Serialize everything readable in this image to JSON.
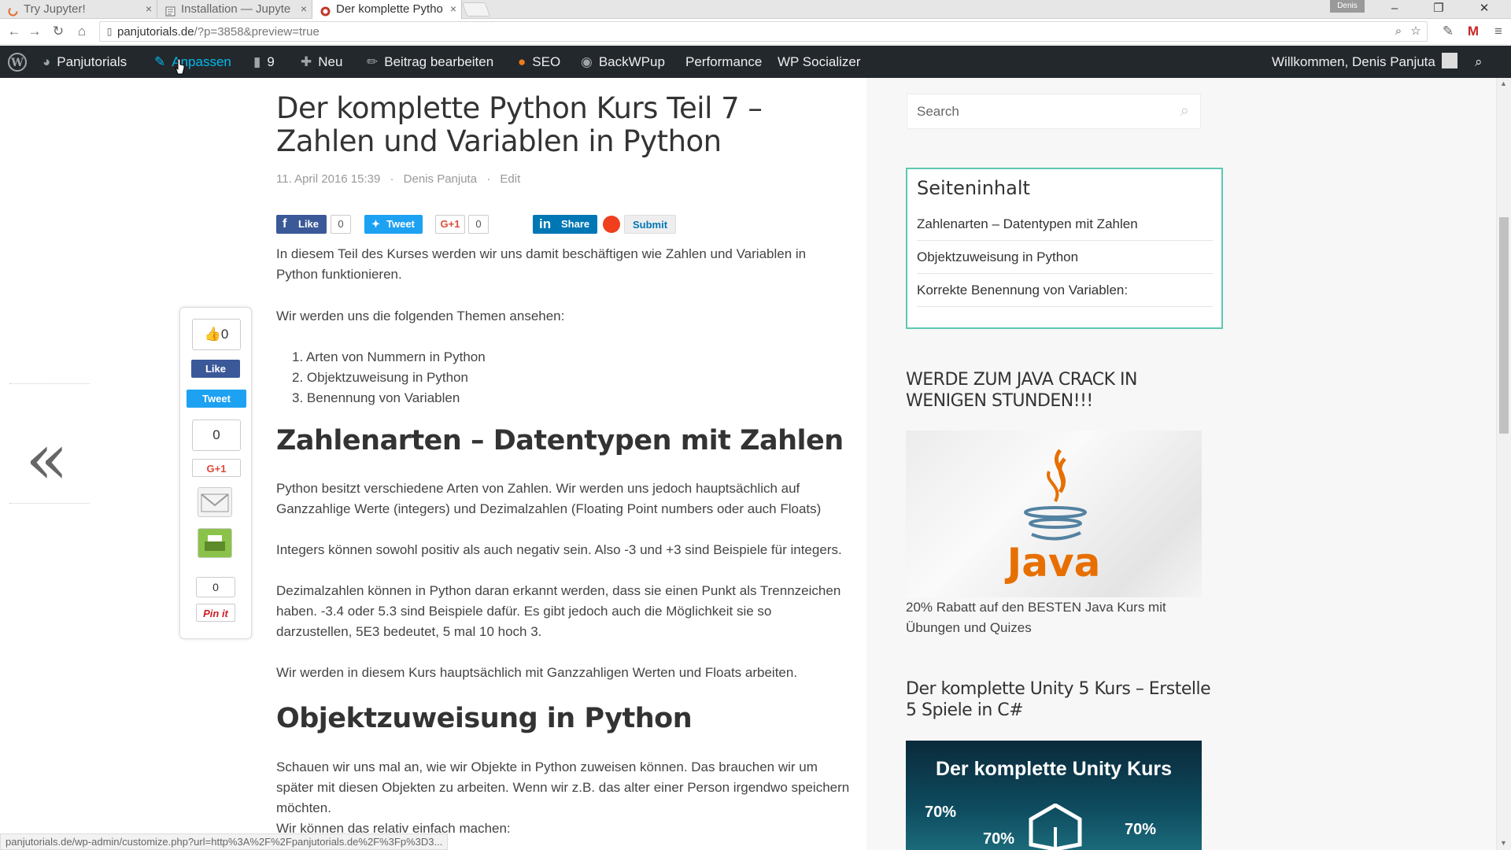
{
  "browser": {
    "tabs": [
      {
        "title": "Try Jupyter!",
        "close": "×"
      },
      {
        "title": "Installation — Jupyte",
        "close": "×"
      },
      {
        "title": "Der komplette Pytho",
        "close": "×"
      }
    ],
    "profile_name": "Denis",
    "window_controls": {
      "minimize": "–",
      "restore": "❐",
      "close": "✕"
    },
    "url": {
      "domain": "panjutorials.de",
      "path": "/?p=3858&preview=true"
    },
    "status_url": "panjutorials.de/wp-admin/customize.php?url=http%3A%2F%2Fpanjutorials.de%2F%3Fp%3D3..."
  },
  "adminbar": {
    "site": "Panjutorials",
    "customize": "Anpassen",
    "comments_count": "9",
    "new": "Neu",
    "edit_post": "Beitrag bearbeiten",
    "seo": "SEO",
    "backwpup": "BackWPup",
    "performance": "Performance",
    "socializer": "WP Socializer",
    "welcome": "Willkommen, Denis Panjuta"
  },
  "article": {
    "title": "Der komplette Python Kurs Teil 7 – Zahlen und Variablen in Python",
    "date": "11. April 2016 15:39",
    "sep1": "·",
    "author": "Denis Panjuta",
    "sep2": "·",
    "edit": "Edit",
    "intro": "In diesem Teil des Kurses werden wir uns damit beschäftigen wie Zahlen und Variablen in Python funktionieren.",
    "topics_intro": "Wir werden uns die folgenden Themen ansehen:",
    "topics": [
      "1. Arten von Nummern in Python",
      "2. Objektzuweisung in Python",
      "3. Benennung von Variablen"
    ],
    "h2_numbers": "Zahlenarten – Datentypen mit Zahlen",
    "p_numbers1": "Python besitzt verschiedene Arten von Zahlen. Wir werden uns jedoch hauptsächlich auf Ganzzahlige Werte (integers) und Dezimalzahlen (Floating Point numbers oder auch Floats)",
    "p_numbers2": "Integers können sowohl positiv als auch negativ sein. Also -3 und +3 sind Beispiele für integers.",
    "p_numbers3": "Dezimalzahlen können in Python daran erkannt werden, dass sie einen Punkt als Trennzeichen haben. -3.4 oder 5.3 sind Beispiele dafür. Es gibt jedoch auch die Möglichkeit sie so darzustellen, 5E3 bedeutet, 5 mal 10 hoch 3.",
    "p_numbers4": "Wir werden in diesem Kurs hauptsächlich mit Ganzzahligen Werten und Floats arbeiten.",
    "h2_objects": "Objektzuweisung in Python",
    "p_objects1": "Schauen wir uns mal an, wie wir Objekte in Python zuweisen können. Das brauchen wir um später mit diesen Objekten zu arbeiten. Wenn wir z.B. das alter einer Person irgendwo speichern möchten.",
    "p_objects2": "Wir können das relativ einfach machen:"
  },
  "share_row": {
    "like": "Like",
    "like_count": "0",
    "tweet": "Tweet",
    "gplus": "G+1",
    "gplus_count": "0",
    "share": "Share",
    "submit": "Submit"
  },
  "floating_share": {
    "thumbs": "👍0",
    "like": "Like",
    "tweet": "Tweet",
    "count2": "0",
    "gplus": "G+1",
    "pin_count": "0",
    "pinit": "Pin it"
  },
  "sidebar": {
    "search_placeholder": "Search",
    "toc_title": "Seiteninhalt",
    "toc_items": [
      "Zahlenarten – Datentypen mit Zahlen",
      "Objektzuweisung in Python",
      "Korrekte Benennung von Variablen:"
    ],
    "java_heading": "WERDE ZUM JAVA CRACK IN WENIGEN STUNDEN!!!",
    "java_logo_text": "Java",
    "java_text": "20% Rabatt auf den BESTEN Java Kurs mit Übungen und Quizes",
    "unity_heading": "Der komplette Unity 5 Kurs – Erstelle 5 Spiele in C#",
    "unity_banner_title": "Der komplette Unity Kurs",
    "unity_pcts": [
      "70%",
      "70%",
      "70%"
    ]
  },
  "colors": {
    "adminbar_bg": "#23282d",
    "accent_hover": "#00b9eb",
    "toc_border": "#5cc8b3",
    "facebook": "#3b5998",
    "twitter": "#1da1f2",
    "linkedin": "#0077b5",
    "gplus": "#dd4b39",
    "java_orange": "#e76f00",
    "java_blue": "#5382a1"
  }
}
